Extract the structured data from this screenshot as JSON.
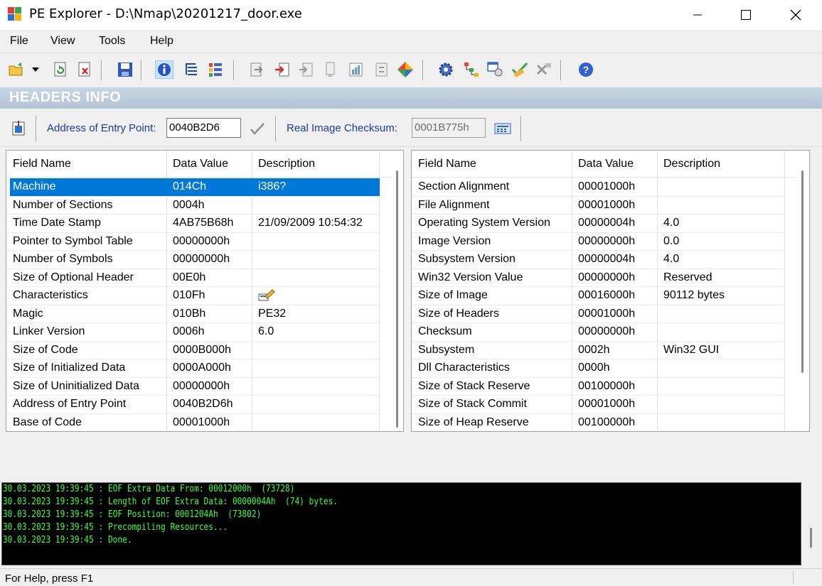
{
  "window": {
    "title": "PE Explorer - D:\\Nmap\\20201217_door.exe"
  },
  "menu": [
    "File",
    "View",
    "Tools",
    "Help"
  ],
  "section": {
    "title": "HEADERS INFO"
  },
  "infobar": {
    "entry_point_label": "Address of Entry Point:",
    "entry_point_value": "0040B2D6",
    "checksum_label": "Real Image Checksum:",
    "checksum_value": "0001B775h"
  },
  "left_table": {
    "columns": [
      "Field Name",
      "Data Value",
      "Description"
    ],
    "rows": [
      [
        "Machine",
        "014Ch",
        "i386?"
      ],
      [
        "Number of Sections",
        "0004h",
        ""
      ],
      [
        "Time Date Stamp",
        "4AB75B68h",
        "21/09/2009  10:54:32"
      ],
      [
        "Pointer to Symbol Table",
        "00000000h",
        ""
      ],
      [
        "Number of Symbols",
        "00000000h",
        ""
      ],
      [
        "Size of Optional Header",
        "00E0h",
        ""
      ],
      [
        "Characteristics",
        "010Fh",
        ""
      ],
      [
        "Magic",
        "010Bh",
        "PE32"
      ],
      [
        "Linker Version",
        "0006h",
        "6.0"
      ],
      [
        "Size of Code",
        "0000B000h",
        ""
      ],
      [
        "Size of Initialized Data",
        "0000A000h",
        ""
      ],
      [
        "Size of Uninitialized Data",
        "00000000h",
        ""
      ],
      [
        "Address of Entry Point",
        "0040B2D6h",
        ""
      ],
      [
        "Base of Code",
        "00001000h",
        ""
      ]
    ]
  },
  "right_table": {
    "columns": [
      "Field Name",
      "Data Value",
      "Description"
    ],
    "rows": [
      [
        "Section Alignment",
        "00001000h",
        ""
      ],
      [
        "File Alignment",
        "00001000h",
        ""
      ],
      [
        "Operating System Version",
        "00000004h",
        "4.0"
      ],
      [
        "Image Version",
        "00000000h",
        "0.0"
      ],
      [
        "Subsystem Version",
        "00000004h",
        "4.0"
      ],
      [
        "Win32 Version Value",
        "00000000h",
        "Reserved"
      ],
      [
        "Size of Image",
        "00016000h",
        "90112 bytes"
      ],
      [
        "Size of Headers",
        "00001000h",
        ""
      ],
      [
        "Checksum",
        "00000000h",
        ""
      ],
      [
        "Subsystem",
        "0002h",
        "Win32 GUI"
      ],
      [
        "Dll Characteristics",
        "0000h",
        ""
      ],
      [
        "Size of Stack Reserve",
        "00100000h",
        ""
      ],
      [
        "Size of Stack Commit",
        "00001000h",
        ""
      ],
      [
        "Size of Heap Reserve",
        "00100000h",
        ""
      ]
    ]
  },
  "log": [
    "30.03.2023 19:39:45 : EOF Extra Data From: 00012000h  (73728)",
    "30.03.2023 19:39:45 : Length of EOF Extra Data: 0000004Ah  (74) bytes.",
    "30.03.2023 19:39:45 : EOF Position: 0001204Ah  (73802)",
    "30.03.2023 19:39:45 : Precompiling Resources...",
    "30.03.2023 19:39:45 : Done."
  ],
  "status": {
    "text": "For Help, press F1"
  },
  "colors": {
    "selection": "#0078d7",
    "log_text": "#3cff3c",
    "header_band": "#b3c4d6"
  }
}
